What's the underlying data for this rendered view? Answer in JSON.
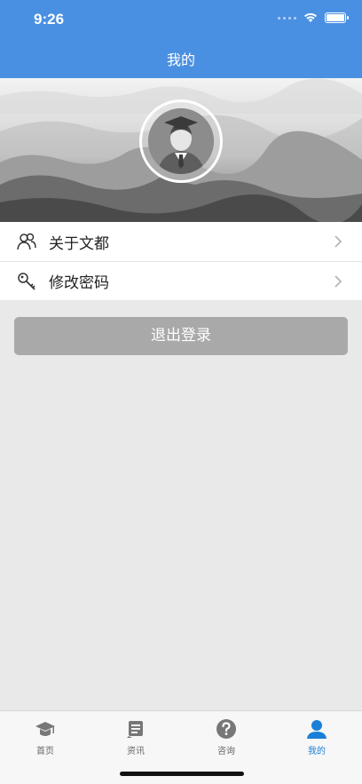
{
  "status": {
    "time": "9:26"
  },
  "nav": {
    "title": "我的"
  },
  "menu": [
    {
      "label": "关于文都",
      "icon": "people-icon"
    },
    {
      "label": "修改密码",
      "icon": "key-icon"
    }
  ],
  "logout_label": "退出登录",
  "tabs": [
    {
      "label": "首页",
      "icon": "graduation-cap-icon",
      "active": false
    },
    {
      "label": "资讯",
      "icon": "news-icon",
      "active": false
    },
    {
      "label": "咨询",
      "icon": "question-icon",
      "active": false
    },
    {
      "label": "我的",
      "icon": "user-icon",
      "active": true
    }
  ],
  "colors": {
    "accent": "#4a90e2",
    "active_tab": "#1a7fd6",
    "logout_bg": "#a9a9a9"
  }
}
